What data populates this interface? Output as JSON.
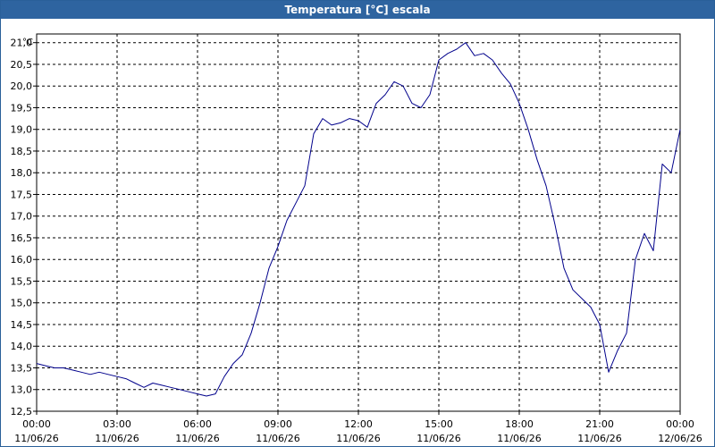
{
  "window": {
    "title": "Temperatura [°C] escala"
  },
  "colors": {
    "titlebar": "#2e64a0",
    "line": "#00008b",
    "grid": "#000000",
    "background": "#ffffff"
  },
  "chart_data": {
    "type": "line",
    "title": "Temperatura [°C] escala",
    "ylabel": "°C",
    "xlabel": "",
    "ylim": [
      12.5,
      21.2
    ],
    "xlim_hours": [
      0,
      24
    ],
    "grid": true,
    "legend": "none",
    "y_ticks": [
      "12,5",
      "13,0",
      "13,5",
      "14,0",
      "14,5",
      "15,0",
      "15,5",
      "16,0",
      "16,5",
      "17,0",
      "17,5",
      "18,0",
      "18,5",
      "19,0",
      "19,5",
      "20,0",
      "20,5",
      "21,0"
    ],
    "x_ticks": [
      {
        "time": "00:00",
        "date": "11/06/26"
      },
      {
        "time": "03:00",
        "date": "11/06/26"
      },
      {
        "time": "06:00",
        "date": "11/06/26"
      },
      {
        "time": "09:00",
        "date": "11/06/26"
      },
      {
        "time": "12:00",
        "date": "11/06/26"
      },
      {
        "time": "15:00",
        "date": "11/06/26"
      },
      {
        "time": "18:00",
        "date": "11/06/26"
      },
      {
        "time": "21:00",
        "date": "11/06/26"
      },
      {
        "time": "00:00",
        "date": "12/06/26"
      }
    ],
    "series": [
      {
        "x": [
          "00:00",
          "00:20",
          "00:40",
          "01:00",
          "01:20",
          "01:40",
          "02:00",
          "02:20",
          "02:40",
          "03:00",
          "03:20",
          "03:40",
          "04:00",
          "04:20",
          "04:40",
          "05:00",
          "05:20",
          "05:40",
          "06:00",
          "06:20",
          "06:40",
          "07:00",
          "07:20",
          "07:40",
          "08:00",
          "08:20",
          "08:40",
          "09:00",
          "09:20",
          "09:40",
          "10:00",
          "10:20",
          "10:40",
          "11:00",
          "11:20",
          "11:40",
          "12:00",
          "12:20",
          "12:40",
          "13:00",
          "13:20",
          "13:40",
          "14:00",
          "14:20",
          "14:40",
          "15:00",
          "15:20",
          "15:40",
          "16:00",
          "16:20",
          "16:40",
          "17:00",
          "17:20",
          "17:40",
          "18:00",
          "18:20",
          "18:40",
          "19:00",
          "19:20",
          "19:40",
          "20:00",
          "20:20",
          "20:40",
          "21:00",
          "21:20",
          "21:40",
          "22:00",
          "22:20",
          "22:40",
          "23:00",
          "23:20",
          "23:40",
          "24:00"
        ],
        "values": [
          13.6,
          13.55,
          13.5,
          13.5,
          13.45,
          13.4,
          13.35,
          13.4,
          13.35,
          13.3,
          13.25,
          13.15,
          13.05,
          13.15,
          13.1,
          13.05,
          13.0,
          12.95,
          12.9,
          12.85,
          12.9,
          13.3,
          13.6,
          13.8,
          14.3,
          15.0,
          15.8,
          16.3,
          16.9,
          17.3,
          17.7,
          18.9,
          19.25,
          19.1,
          19.15,
          19.25,
          19.2,
          19.05,
          19.6,
          19.8,
          20.1,
          20.0,
          19.6,
          19.5,
          19.8,
          20.6,
          20.75,
          20.85,
          21.0,
          20.7,
          20.75,
          20.6,
          20.3,
          20.05,
          19.6,
          19.0,
          18.3,
          17.7,
          16.8,
          15.8,
          15.3,
          15.1,
          14.9,
          14.5,
          13.4,
          13.9,
          14.3,
          16.0,
          16.6,
          16.2,
          18.2,
          18.0,
          19.0
        ]
      }
    ]
  }
}
